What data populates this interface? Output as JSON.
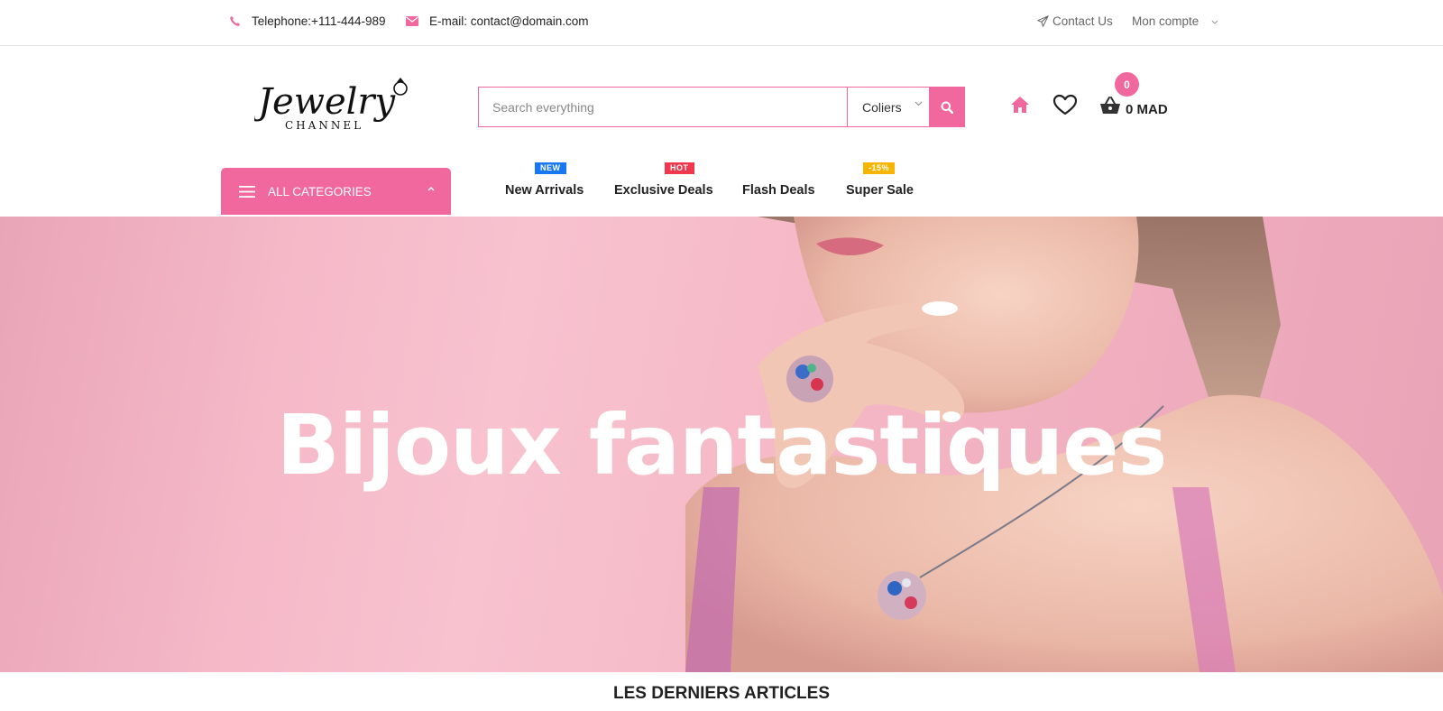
{
  "topbar": {
    "phone": "Telephone:+111-444-989",
    "email": "E-mail: contact@domain.com",
    "contact_label": "Contact Us",
    "account_label": "Mon compte"
  },
  "logo": {
    "text": "Jewelry",
    "sub": "CHANNEL"
  },
  "search": {
    "placeholder": "Search everything",
    "category": "Coliers"
  },
  "cart": {
    "count": "0",
    "total": "0 MAD"
  },
  "categories_button": "ALL CATEGORIES",
  "menu": [
    {
      "label": "New Arrivals",
      "tag": "NEW"
    },
    {
      "label": "Exclusive Deals",
      "tag": "HOT"
    },
    {
      "label": "Flash Deals",
      "tag": ""
    },
    {
      "label": "Super Sale",
      "tag": "-15%"
    }
  ],
  "hero": {
    "title": "Bijoux fantastiques"
  },
  "section": {
    "title": "LES DERNIERS ARTICLES"
  },
  "colors": {
    "accent": "#f0689d",
    "tag_new": "#1877f2",
    "tag_hot": "#f2364b",
    "tag_sale": "#f7b500"
  }
}
